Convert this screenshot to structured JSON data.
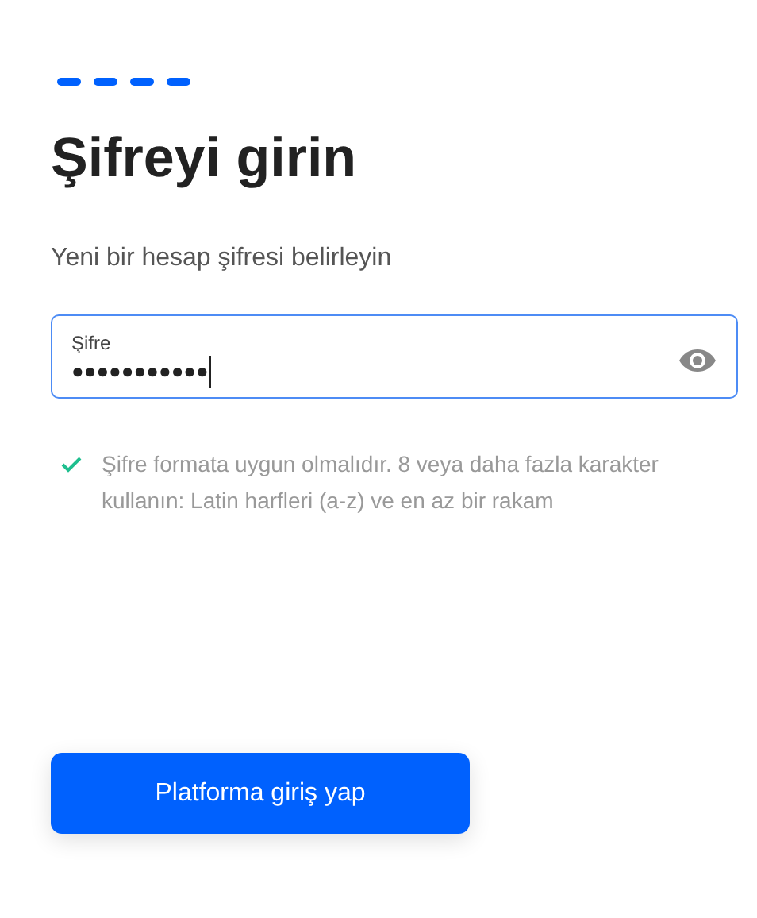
{
  "steps": [
    {
      "done": true
    },
    {
      "done": true
    },
    {
      "done": true
    },
    {
      "done": true
    }
  ],
  "title": "Şifreyi girin",
  "subtitle": "Yeni bir hesap şifresi belirleyin",
  "password_field": {
    "label": "Şifre",
    "value": "●●●●●●●●●●●",
    "focused": true
  },
  "hint": {
    "valid": true,
    "text": "Şifre formata uygun olmalıdır. 8 veya daha fazla karakter kullanın: Latin harfleri (a-z) ve en az bir rakam"
  },
  "submit_button": {
    "label": "Platforma giriş yap"
  }
}
